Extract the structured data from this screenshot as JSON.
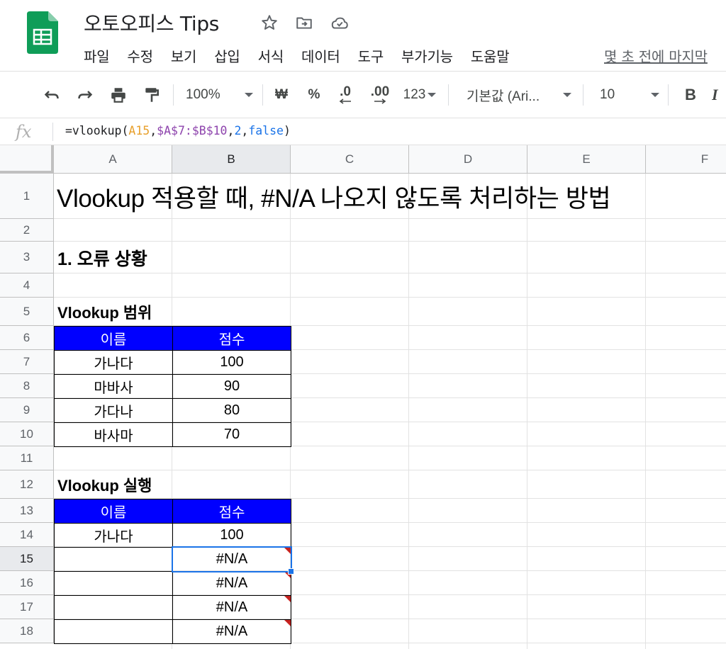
{
  "app": {
    "doc_title": "오토오피스 Tips",
    "brand_color": "#0f9d58",
    "menu": [
      "파일",
      "수정",
      "보기",
      "삽입",
      "서식",
      "데이터",
      "도구",
      "부가기능",
      "도움말"
    ],
    "last_edit": "몇 초 전에 마지막"
  },
  "toolbar": {
    "zoom": "100%",
    "currency": "₩",
    "percent": "%",
    "decimal_decrease": ".0",
    "decimal_increase": ".00",
    "number_format": "123",
    "font_name": "기본값 (Ari...",
    "font_size": "10",
    "bold": "B",
    "italic": "I"
  },
  "formula_bar": {
    "fx": "fx",
    "tokens": [
      {
        "text": "=vlookup(",
        "color": "#202124"
      },
      {
        "text": "A15",
        "color": "#e8a02c"
      },
      {
        "text": ",",
        "color": "#202124"
      },
      {
        "text": "$A$7:$B$10",
        "color": "#8e44ad"
      },
      {
        "text": ",",
        "color": "#202124"
      },
      {
        "text": "2",
        "color": "#1a73e8"
      },
      {
        "text": ",",
        "color": "#202124"
      },
      {
        "text": "false",
        "color": "#1a73e8"
      },
      {
        "text": ")",
        "color": "#202124"
      }
    ]
  },
  "grid": {
    "columns": [
      "A",
      "B",
      "C",
      "D",
      "E",
      "F"
    ],
    "rows": [
      "1",
      "2",
      "3",
      "4",
      "5",
      "6",
      "7",
      "8",
      "9",
      "10",
      "11",
      "12",
      "13",
      "14",
      "15",
      "16",
      "17",
      "18"
    ],
    "active_cell": "B15",
    "header_fill": "#0000ff",
    "selection_color": "#1a73e8",
    "error_marker_color": "#c5221f"
  },
  "sheet": {
    "title": "Vlookup 적용할 때, #N/A 나오지 않도록 처리하는 방법",
    "section1": "1. 오류 상황",
    "range_title": "Vlookup 범위",
    "exec_title": "Vlookup 실행",
    "range_table": {
      "headers": [
        "이름",
        "점수"
      ],
      "rows": [
        [
          "가나다",
          "100"
        ],
        [
          "마바사",
          "90"
        ],
        [
          "가다나",
          "80"
        ],
        [
          "바사마",
          "70"
        ]
      ]
    },
    "exec_table": {
      "headers": [
        "이름",
        "점수"
      ],
      "rows": [
        [
          "가나다",
          "100"
        ],
        [
          "",
          "#N/A"
        ],
        [
          "",
          "#N/A"
        ],
        [
          "",
          "#N/A"
        ],
        [
          "",
          "#N/A"
        ]
      ]
    }
  }
}
